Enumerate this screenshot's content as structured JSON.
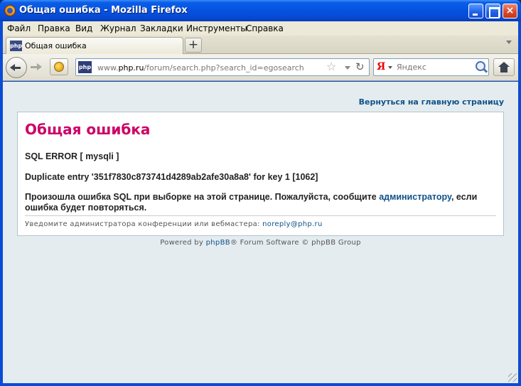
{
  "window": {
    "title": "Общая ошибка - Mozilla Firefox",
    "controls": {
      "minimize": "",
      "maximize": "",
      "close": "×"
    }
  },
  "menu": [
    "Файл",
    "Правка",
    "Вид",
    "Журнал",
    "Закладки",
    "Инструменты",
    "Справка"
  ],
  "tab": {
    "favicon_text": "php",
    "label": "Общая ошибка",
    "new_tab_label": "+"
  },
  "navbar": {
    "site_icon_text": "php",
    "url_prefix": "www.",
    "url_domain": "php.ru",
    "url_path": "/forum/search.php?search_id=egosearch",
    "search_engine_glyph": "Я",
    "search_placeholder": "Яндекс",
    "star_glyph": "☆",
    "reload_glyph": "↻"
  },
  "page": {
    "return_link": "Вернуться на главную страницу",
    "heading": "Общая ошибка",
    "sql_error": "SQL ERROR [ mysqli ]",
    "duplicate": "Duplicate entry '351f7830c873741d4289ab2afe30a8a8' for key 1 [1062]",
    "message_before": "Произошла ошибка SQL при выборке на этой странице. Пожалуйста, сообщите ",
    "message_link": "администратору",
    "message_after": ", если ошибка будет повторяться.",
    "notice_text": "Уведомите администратора конференции или вебмастера: ",
    "notice_email": "noreply@php.ru",
    "footer_before": "Powered by ",
    "footer_link": "phpBB",
    "footer_after": "® Forum Software © phpBB Group"
  },
  "colors": {
    "heading": "#cc0066",
    "link": "#105289",
    "background": "#e4ecf0"
  }
}
